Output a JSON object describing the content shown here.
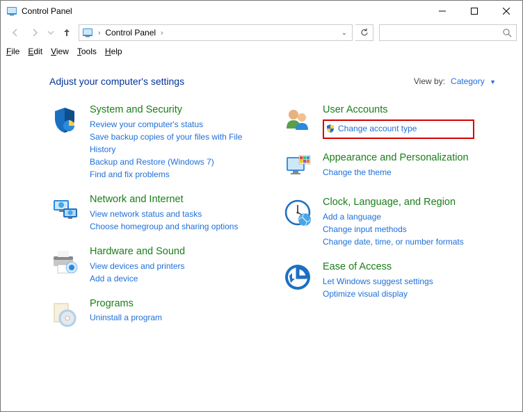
{
  "window": {
    "title": "Control Panel"
  },
  "address": {
    "crumb": "Control Panel"
  },
  "menus": [
    "File",
    "Edit",
    "View",
    "Tools",
    "Help"
  ],
  "header": {
    "heading": "Adjust your computer's settings",
    "viewby_label": "View by:",
    "viewby_value": "Category"
  },
  "left_categories": [
    {
      "title": "System and Security",
      "links": [
        "Review your computer's status",
        "Save backup copies of your files with File History",
        "Backup and Restore (Windows 7)",
        "Find and fix problems"
      ]
    },
    {
      "title": "Network and Internet",
      "links": [
        "View network status and tasks",
        "Choose homegroup and sharing options"
      ]
    },
    {
      "title": "Hardware and Sound",
      "links": [
        "View devices and printers",
        "Add a device"
      ]
    },
    {
      "title": "Programs",
      "links": [
        "Uninstall a program"
      ]
    }
  ],
  "right_categories": [
    {
      "title": "User Accounts",
      "links": [
        "Change account type"
      ],
      "shield_links": [
        0
      ],
      "highlighted": true
    },
    {
      "title": "Appearance and Personalization",
      "links": [
        "Change the theme"
      ]
    },
    {
      "title": "Clock, Language, and Region",
      "links": [
        "Add a language",
        "Change input methods",
        "Change date, time, or number formats"
      ]
    },
    {
      "title": "Ease of Access",
      "links": [
        "Let Windows suggest settings",
        "Optimize visual display"
      ]
    }
  ]
}
